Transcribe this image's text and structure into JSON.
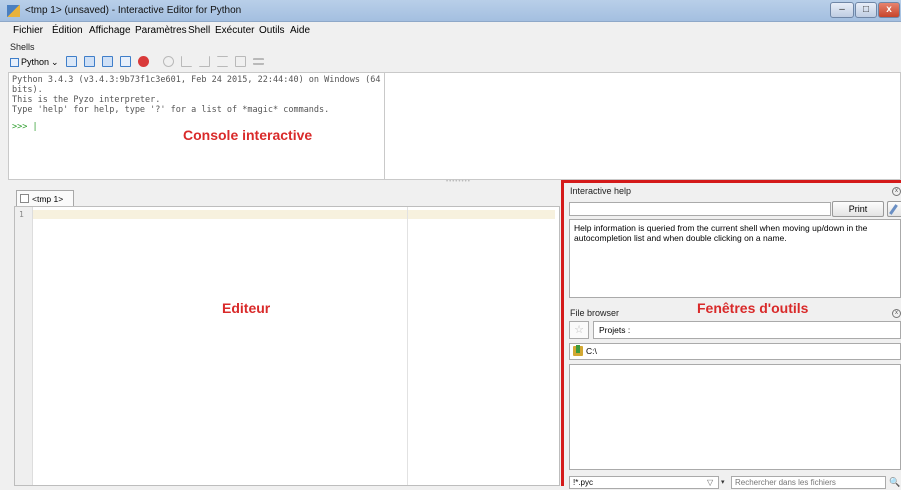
{
  "window": {
    "title": "<tmp 1> (unsaved) - Interactive Editor for Python",
    "minimize_label": "–",
    "maximize_label": "□",
    "close_label": "x"
  },
  "menu": [
    "Fichier",
    "Édition",
    "Affichage",
    "Paramètres",
    "Shell",
    "Exécuter",
    "Outils",
    "Aide"
  ],
  "shells_label": "Shells",
  "toolbar": {
    "python_label": "Python",
    "python_dropdown": "⌄",
    "icons": [
      "new-shell-icon",
      "interrupt-icon",
      "restart-icon",
      "clear-icon",
      "terminate-icon",
      "debug-icon",
      "step-into-icon",
      "step-over-icon",
      "step-out-icon",
      "stop-debug-icon",
      "stack-icon"
    ],
    "colors": {
      "terminate": "#d93a3a",
      "active": "#3f7ec9",
      "disabled": "#b9b9b9"
    }
  },
  "console": {
    "lines": [
      "Python 3.4.3 (v3.4.3:9b73f1c3e601, Feb 24 2015, 22:44:40) on Windows (64 bits).",
      "This is the Pyzo interpreter.",
      "Type 'help' for help, type '?' for a list of *magic* commands."
    ],
    "prompt": ">>> |"
  },
  "annotations": {
    "console": "Console interactive",
    "editor": "Editeur",
    "tools": "Fenêtres d'outils",
    "color": "#d92a2a"
  },
  "editor": {
    "tab_label": "<tmp 1>",
    "line_number": "1"
  },
  "interactive_help": {
    "title": "Interactive help",
    "close_label": "x",
    "input_value": "",
    "print_label": "Print",
    "text": "Help information is queried from the current shell when moving up/down in the autocompletion list and when double clicking on a name."
  },
  "file_browser": {
    "title": "File browser",
    "close_label": "x",
    "star_label": "☆",
    "projects_label": "Projets :",
    "path": "C:\\",
    "filter_value": "!*.pyc",
    "filter_icon": "▽",
    "dropdown": "▾",
    "search_placeholder": "Rechercher dans les fichiers",
    "search_icon": "🔍"
  }
}
